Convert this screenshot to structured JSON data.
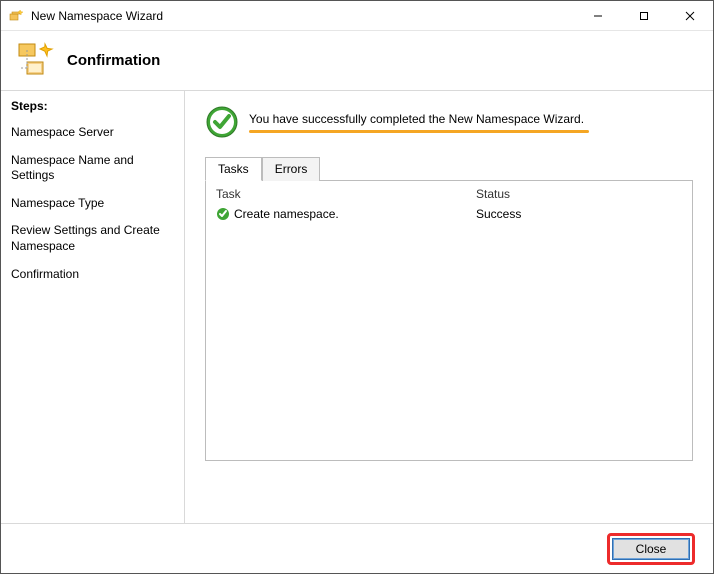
{
  "window": {
    "title": "New Namespace Wizard"
  },
  "header": {
    "title": "Confirmation"
  },
  "sidebar": {
    "steps_label": "Steps:",
    "steps": [
      "Namespace Server",
      "Namespace Name and Settings",
      "Namespace Type",
      "Review Settings and Create Namespace",
      "Confirmation"
    ]
  },
  "success": {
    "message": "You have successfully completed the New Namespace Wizard."
  },
  "tabs": {
    "tasks_label": "Tasks",
    "errors_label": "Errors"
  },
  "results": {
    "col_task": "Task",
    "col_status": "Status",
    "rows": [
      {
        "task": "Create namespace.",
        "status": "Success"
      }
    ]
  },
  "footer": {
    "close_label": "Close"
  }
}
